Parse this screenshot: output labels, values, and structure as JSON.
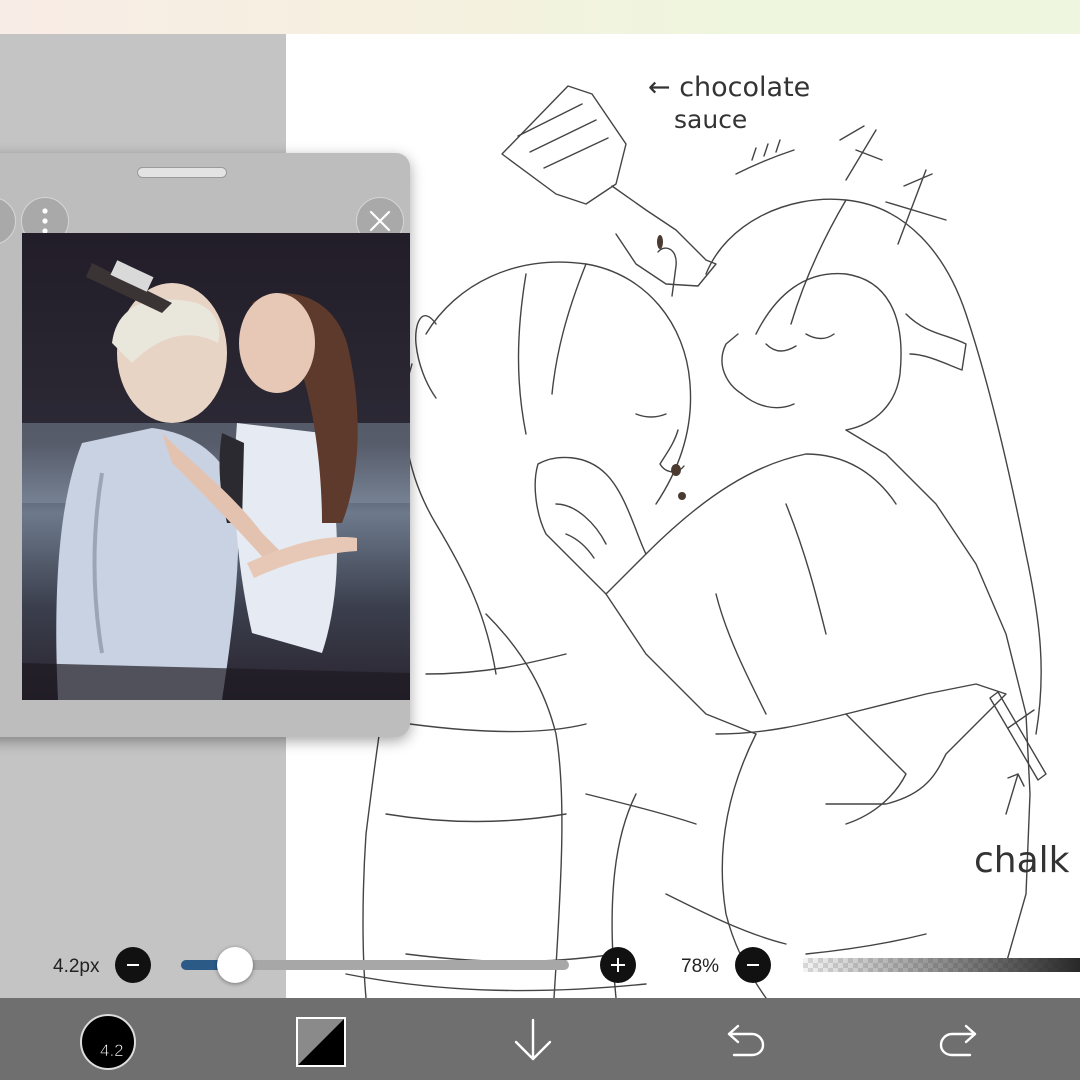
{
  "canvas": {
    "annotations": {
      "sauce_note_line1": "← chocolate",
      "sauce_note_line2": "sauce",
      "chalk_note": "chalk"
    }
  },
  "reference_panel": {
    "menu_icon": "more-vertical-icon",
    "close_icon": "close-icon"
  },
  "brush": {
    "size_label": "4.2px",
    "size_value": 4.2,
    "size_fraction": 0.14,
    "decrease_icon": "minus-icon",
    "increase_icon": "plus-icon"
  },
  "opacity": {
    "label": "78%",
    "value": 78,
    "decrease_icon": "minus-icon"
  },
  "toolbar": {
    "brush_button_label": "4.2",
    "color_icon": "color-swatch-icon",
    "download_icon": "arrow-down-icon",
    "undo_icon": "undo-icon",
    "redo_icon": "redo-icon"
  }
}
